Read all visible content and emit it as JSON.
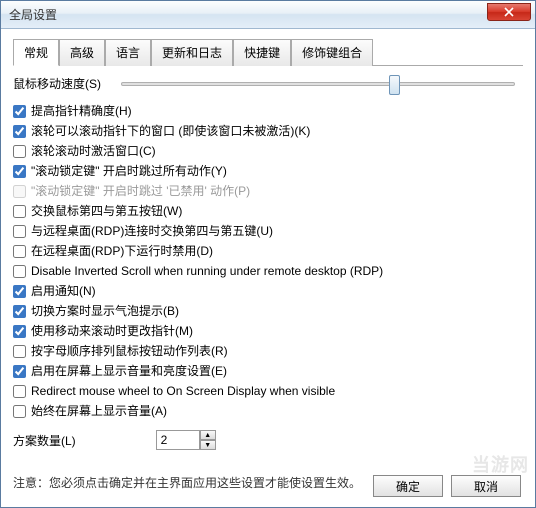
{
  "window": {
    "title": "全局设置"
  },
  "tabs": [
    {
      "label": "常规",
      "active": true
    },
    {
      "label": "高级"
    },
    {
      "label": "语言"
    },
    {
      "label": "更新和日志"
    },
    {
      "label": "快捷键"
    },
    {
      "label": "修饰键组合"
    }
  ],
  "slider": {
    "label": "鼠标移动速度(S)",
    "value": 68
  },
  "options": [
    {
      "label": "提高指针精确度(H)",
      "checked": true,
      "disabled": false
    },
    {
      "label": "滚轮可以滚动指针下的窗口 (即使该窗口未被激活)(K)",
      "checked": true,
      "disabled": false
    },
    {
      "label": "滚轮滚动时激活窗口(C)",
      "checked": false,
      "disabled": false
    },
    {
      "label": "\"滚动锁定键\" 开启时跳过所有动作(Y)",
      "checked": true,
      "disabled": false
    },
    {
      "label": "\"滚动锁定键\" 开启时跳过 '已禁用' 动作(P)",
      "checked": false,
      "disabled": true
    },
    {
      "label": "交换鼠标第四与第五按钮(W)",
      "checked": false,
      "disabled": false
    },
    {
      "label": "与远程桌面(RDP)连接时交换第四与第五键(U)",
      "checked": false,
      "disabled": false
    },
    {
      "label": "在远程桌面(RDP)下运行时禁用(D)",
      "checked": false,
      "disabled": false
    },
    {
      "label": "Disable Inverted Scroll when running under remote desktop (RDP)",
      "checked": false,
      "disabled": false
    },
    {
      "label": "启用通知(N)",
      "checked": true,
      "disabled": false
    },
    {
      "label": "切换方案时显示气泡提示(B)",
      "checked": true,
      "disabled": false
    },
    {
      "label": "使用移动来滚动时更改指针(M)",
      "checked": true,
      "disabled": false
    },
    {
      "label": "按字母顺序排列鼠标按钮动作列表(R)",
      "checked": false,
      "disabled": false
    },
    {
      "label": "启用在屏幕上显示音量和亮度设置(E)",
      "checked": true,
      "disabled": false
    },
    {
      "label": "Redirect mouse wheel to On Screen Display when visible",
      "checked": false,
      "disabled": false
    },
    {
      "label": "始终在屏幕上显示音量(A)",
      "checked": false,
      "disabled": false
    }
  ],
  "spinner": {
    "label": "方案数量(L)",
    "value": "2"
  },
  "notice": "注意：您必须点击确定并在主界面应用这些设置才能使设置生效。",
  "buttons": {
    "ok": "确定",
    "cancel": "取消"
  },
  "watermark": "当游网"
}
